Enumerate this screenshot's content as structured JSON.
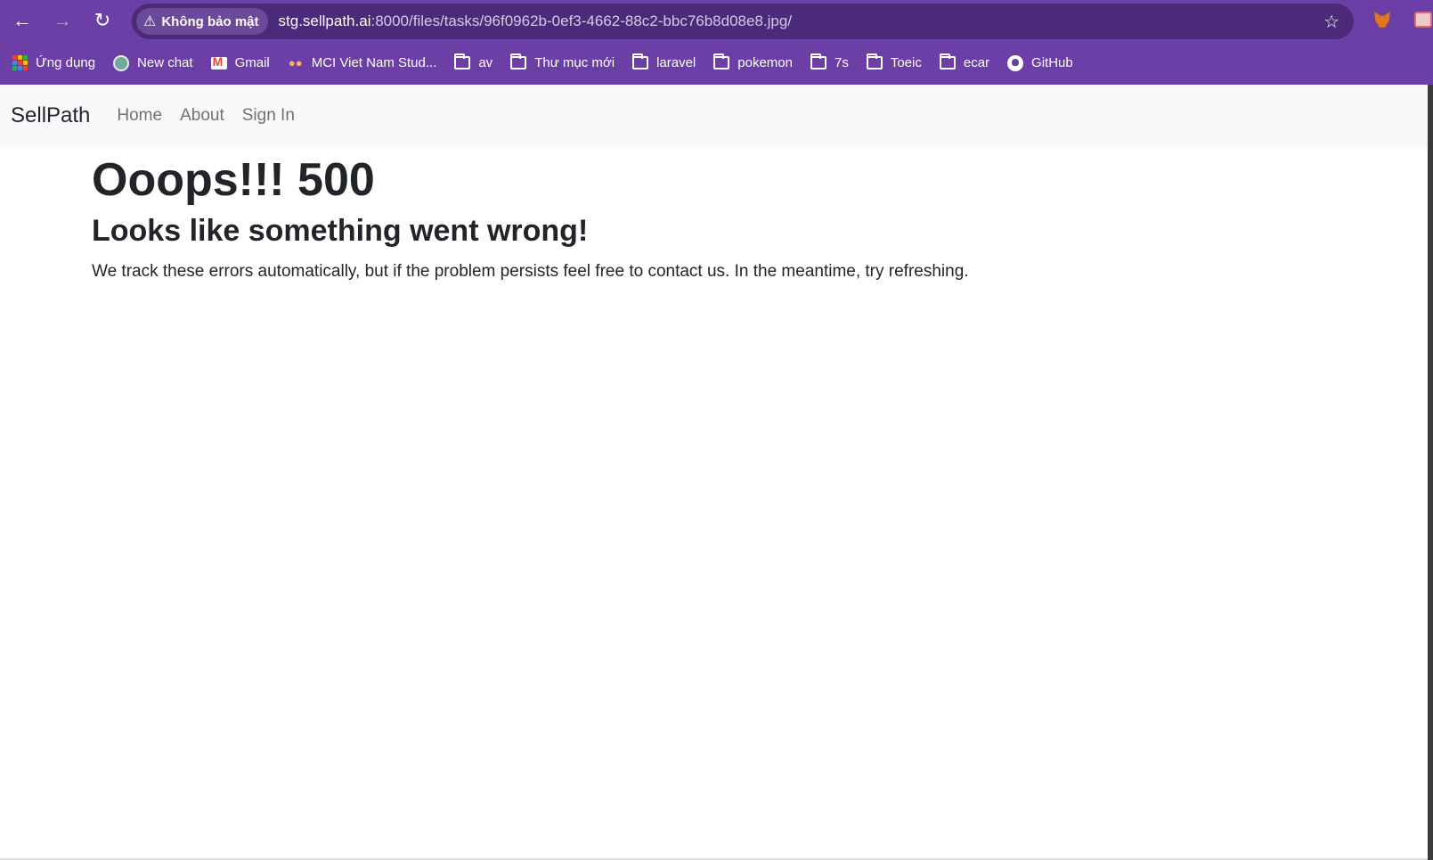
{
  "browser": {
    "security_label": "Không bảo mật",
    "url_host": "stg.sellpath.ai",
    "url_rest": ":8000/files/tasks/96f0962b-0ef3-4662-88c2-bbc76b8d08e8.jpg/",
    "bookmarks": [
      {
        "label": "Ứng dụng",
        "icon": "apps-icon"
      },
      {
        "label": "New chat",
        "icon": "chatgpt-icon"
      },
      {
        "label": "Gmail",
        "icon": "gmail-icon"
      },
      {
        "label": "MCI Viet Nam Stud...",
        "icon": "mci-icon"
      },
      {
        "label": "av",
        "icon": "folder-icon"
      },
      {
        "label": "Thư mục mới",
        "icon": "folder-icon"
      },
      {
        "label": "laravel",
        "icon": "folder-icon"
      },
      {
        "label": "pokemon",
        "icon": "folder-icon"
      },
      {
        "label": "7s",
        "icon": "folder-icon"
      },
      {
        "label": "Toeic",
        "icon": "folder-icon"
      },
      {
        "label": "ecar",
        "icon": "folder-icon"
      },
      {
        "label": "GitHub",
        "icon": "github-icon"
      }
    ],
    "theme_color": "#6b3fa6"
  },
  "navbar": {
    "brand": "SellPath",
    "links": [
      "Home",
      "About",
      "Sign In"
    ]
  },
  "error": {
    "title": "Ooops!!! 500",
    "subtitle": "Looks like something went wrong!",
    "message": "We track these errors automatically, but if the problem persists feel free to contact us. In the meantime, try refreshing."
  }
}
